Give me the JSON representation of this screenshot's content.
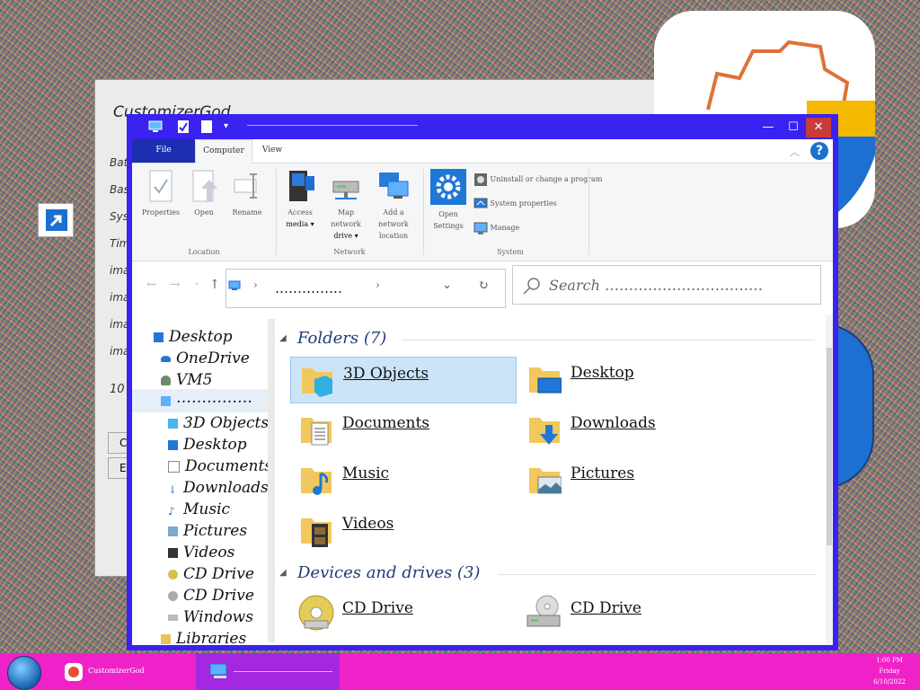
{
  "background_window": {
    "title": "CustomizerGod",
    "items": [
      "Bat",
      "Bas",
      "Syst",
      "Tim",
      "ima",
      "ima",
      "ima",
      "ima"
    ],
    "number_label": "10",
    "buttons": [
      "C",
      "E"
    ]
  },
  "window": {
    "title_path": "",
    "minimize": "—",
    "maximize": "☐",
    "close": "✕"
  },
  "ribbon": {
    "tabs": [
      "File",
      "Computer",
      "View"
    ],
    "location_group": "Location",
    "network_group": "Network",
    "system_group": "System",
    "properties": "Properties",
    "open": "Open",
    "rename": "Rename",
    "access_media_1": "Access",
    "access_media_2": "media ▾",
    "map_drive_1": "Map network",
    "map_drive_2": "drive ▾",
    "add_location_1": "Add a network",
    "add_location_2": "location",
    "open_settings_1": "Open",
    "open_settings_2": "Settings",
    "uninstall": "Uninstall or change a program",
    "system_properties": "System properties",
    "manage": "Manage"
  },
  "address": {
    "path": "……………",
    "search_placeholder": "Search ……………………………"
  },
  "nav": {
    "items": [
      "Desktop",
      "OneDrive",
      "VM5",
      "……………",
      "3D Objects",
      "Desktop",
      "Documents",
      "Downloads",
      "Music",
      "Pictures",
      "Videos",
      "CD Drive",
      "CD Drive",
      "Windows",
      "Libraries"
    ]
  },
  "content": {
    "folders_header": "Folders (7)",
    "folders": [
      "3D Objects",
      "Desktop",
      "Documents",
      "Downloads",
      "Music",
      "Pictures",
      "Videos"
    ],
    "devices_header": "Devices and drives (3)",
    "drives": [
      "CD Drive",
      "CD Drive"
    ]
  },
  "taskbar": {
    "app1": "CustomizerGod",
    "app2": "",
    "time": "1:00 PM",
    "day": "Friday",
    "date": "6/10/2022"
  },
  "colors": {
    "window_border": "#3a22f0",
    "file_tab": "#1c2fb0",
    "taskbar": "#ee22c8",
    "selection": "#cce4f7"
  }
}
